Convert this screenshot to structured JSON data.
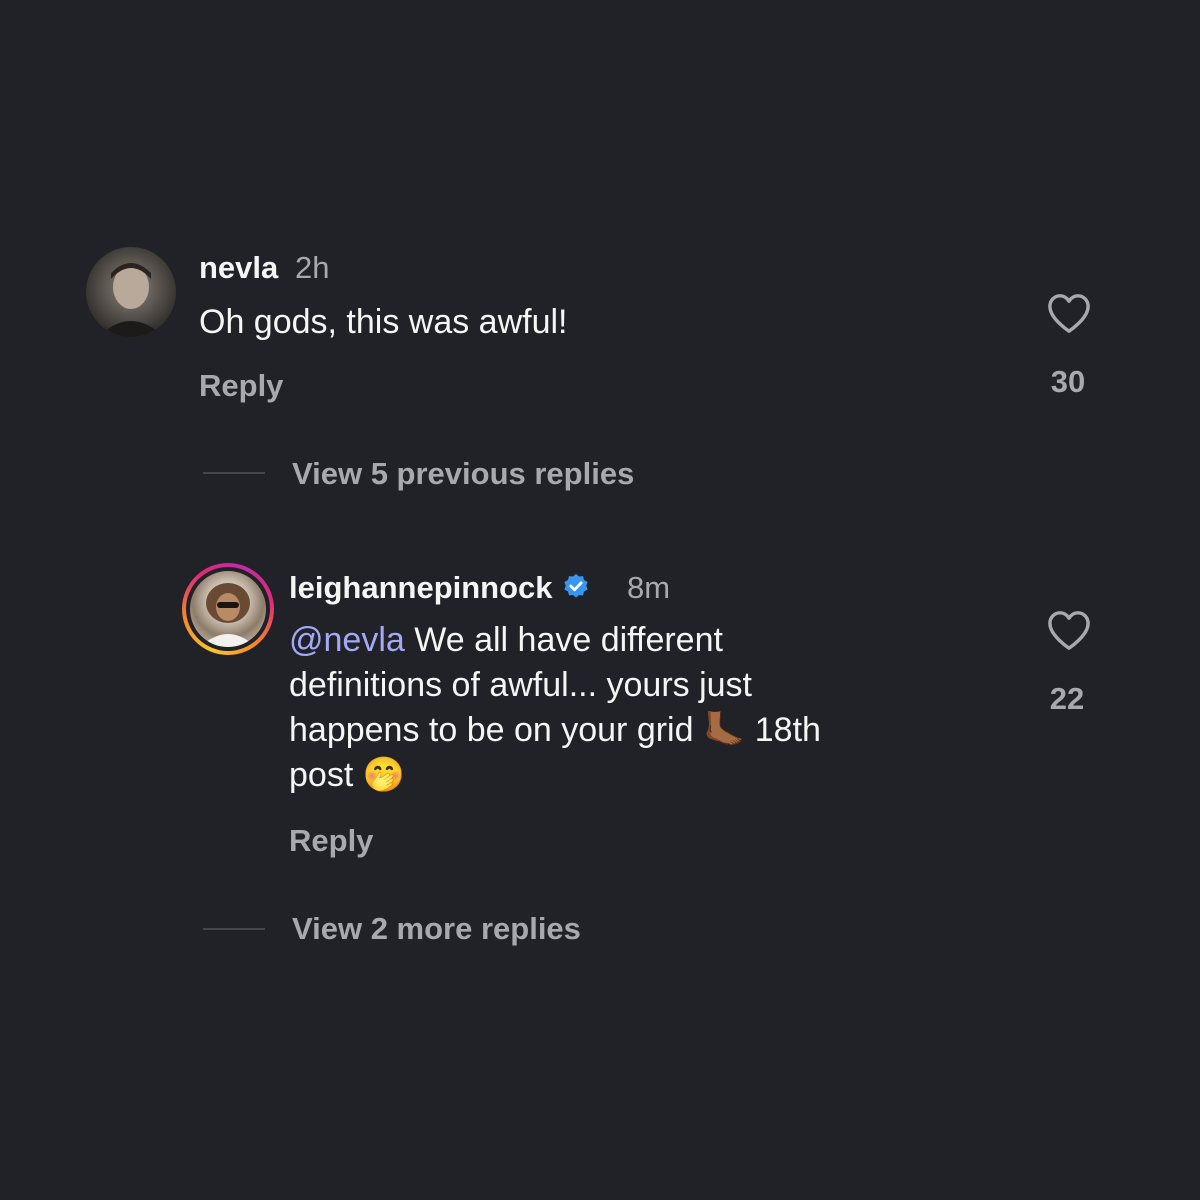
{
  "comment": {
    "username": "nevla",
    "time": "2h",
    "text": "Oh gods, this was awful!",
    "reply_label": "Reply",
    "like_count": "30",
    "view_replies": "View 5 previous replies"
  },
  "reply": {
    "username": "leighannepinnock",
    "time": "8m",
    "mention": "@nevla",
    "text_line1": " We all have different",
    "text_line2": "definitions of awful... yours just",
    "text_line3a": "happens to be on your grid ",
    "emoji_foot": "🦶🏾",
    "text_line3b": " 18th",
    "text_line4": "post ",
    "emoji_face": "🤭",
    "reply_label": "Reply",
    "like_count": "22",
    "view_replies": "View 2 more replies"
  },
  "icons": {
    "heart": "heart-icon",
    "verified": "verified-badge-icon"
  },
  "colors": {
    "background": "#212227",
    "mention": "#a4a8f6",
    "secondary_text": "#a8a8ad",
    "verified": "#3797f0"
  }
}
